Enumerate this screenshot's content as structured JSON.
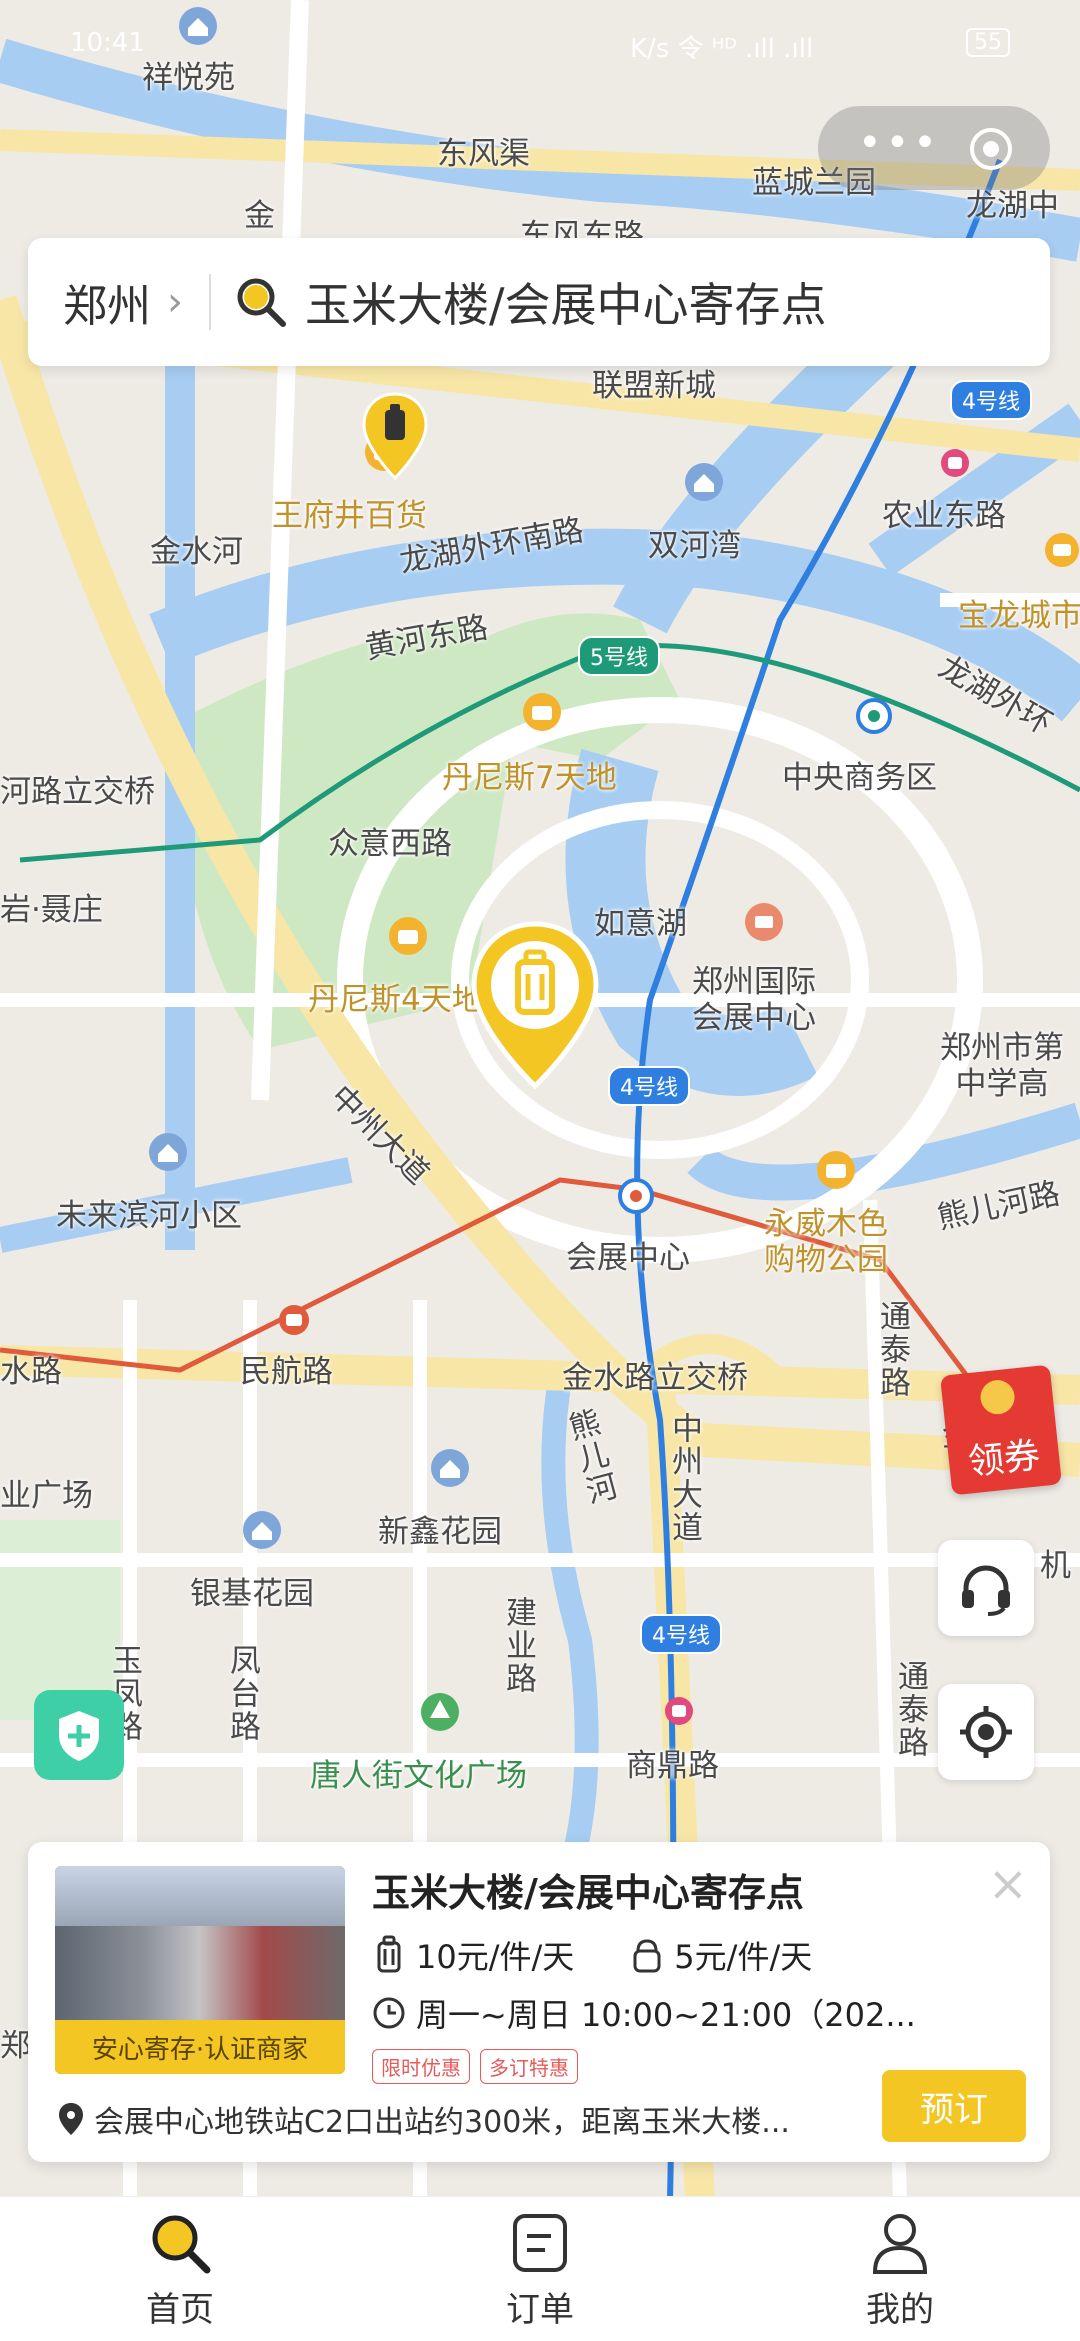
{
  "status_bar": {
    "time": "10:41",
    "info": "K/s 令 ᴴᴰ .ıll .ıll",
    "battery": "55"
  },
  "search": {
    "city": "郑州",
    "query": "玉米大楼/会展中心寄存点"
  },
  "map": {
    "labels": {
      "xiangyueyuan": "祥悦苑",
      "dongfengqu": "东风渠",
      "lanchenglanyuan": "蓝城兰园",
      "longhuzhong": "龙湖中",
      "dongfengdong": "东风东路",
      "jin": "金",
      "lianmeng": "联盟新城",
      "wangfujing": "王府井百货",
      "longhuwaihuan_s": "龙湖外环南路",
      "shuanghewan": "双河湾",
      "nongyedong": "农业东路",
      "jinshuihe": "金水河",
      "baolong": "宝龙城市",
      "huanghedong": "黄河东路",
      "longhuwaihuan_e": "龙湖外环",
      "danis7": "丹尼斯7天地",
      "cbd": "中央商务区",
      "heluliji": "河路立交桥",
      "zhongyixi": "众意西路",
      "yanjiezhuang": "岩·聂庄",
      "ruyihu": "如意湖",
      "zhengzhou_conv": "郑州国际\n会展中心",
      "danis4": "丹尼斯4天地",
      "zhengzhou_school": "郑州市第\n中学高",
      "zhongzhou_avenue": "中州大道",
      "weilai": "未来滨河小区",
      "huizhan": "会展中心",
      "yongwei": "永威木色\n购物公园",
      "xionger": "熊儿河路",
      "minhang": "民航路",
      "tongtai1": "通泰路",
      "shuilu": "水路",
      "jinshui_bridge": "金水路立交桥",
      "zhongzhou_vert": "中州大道",
      "xionger_he": "熊儿河",
      "yeguangchang": "业广场",
      "xinxin": "新鑫花园",
      "yinji": "银基花园",
      "jianye": "建业路",
      "yufeng": "玉凤路",
      "fengtai": "凤台路",
      "tangren": "唐人街文化广场",
      "tongtai2": "通泰路",
      "shangding": "商鼎路",
      "jin2": "金",
      "jiadong": "机",
      "zheng": "郑",
      "hua": "花",
      "lu": "路"
    },
    "line_badges": {
      "line4_a": "4号线",
      "line5": "5号线",
      "line4_b": "4号线",
      "line4_c": "4号线"
    }
  },
  "coupon": {
    "label": "领券"
  },
  "card": {
    "title": "玉米大楼/会展中心寄存点",
    "thumb_label": "安心寄存·认证商家",
    "price_large": "10元/件/天",
    "price_small": "5元/件/天",
    "hours": "周一~周日 10:00~21:00（202...",
    "tags": [
      "限时优惠",
      "多订特惠"
    ],
    "address": "会展中心地铁站C2口出站约300米，距离玉米大楼...",
    "book_label": "预订",
    "close": "×"
  },
  "tabbar": {
    "home": "首页",
    "orders": "订单",
    "mine": "我的"
  },
  "colors": {
    "accent": "#f3c623",
    "line4": "#2f7fe0",
    "line5": "#1f9a78",
    "line1": "#e05a3c"
  }
}
